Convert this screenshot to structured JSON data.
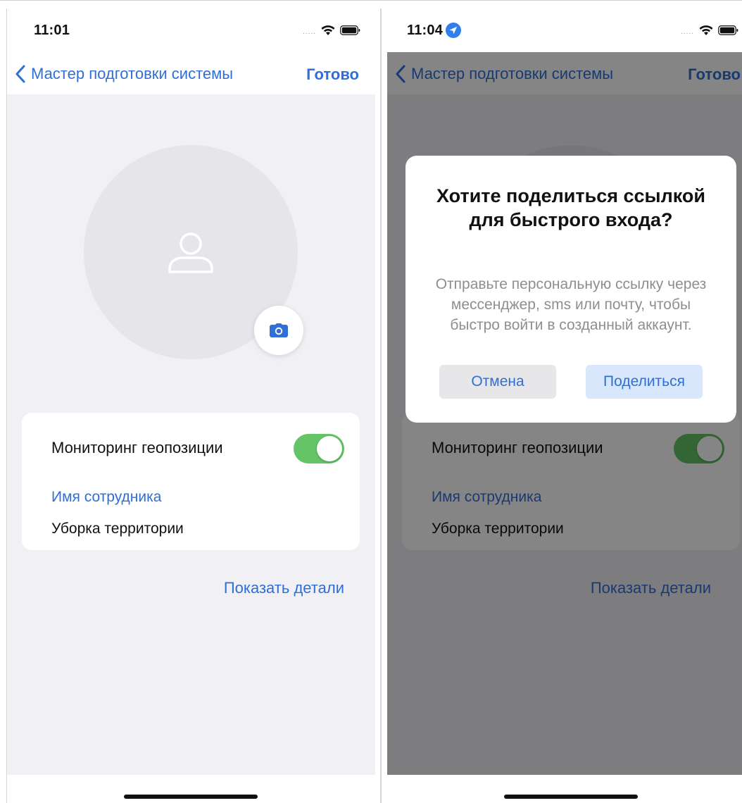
{
  "left_screen": {
    "status": {
      "time": "11:01",
      "signal_text": "....."
    },
    "nav": {
      "back_label": "Мастер подготовки системы",
      "done_label": "Готово"
    },
    "form": {
      "geo_label": "Мониторинг геопозиции",
      "geo_enabled": true,
      "employee_name_label": "Имя сотрудника",
      "employee_name_value": "Уборка территории"
    },
    "details_link": "Показать детали"
  },
  "right_screen": {
    "status": {
      "time": "11:04",
      "signal_text": "....."
    },
    "nav": {
      "back_label": "Мастер подготовки системы",
      "done_label": "Готово"
    },
    "form": {
      "geo_label": "Мониторинг геопозиции",
      "geo_enabled": true,
      "employee_name_label": "Имя сотрудника",
      "employee_name_value": "Уборка территории"
    },
    "details_link": "Показать детали",
    "alert": {
      "title": "Хотите поделиться ссылкой для быстрого входа?",
      "message": "Отправьте персональную ссылку через мессенджер, sms или почту, чтобы быстро войти в созданный аккаунт.",
      "cancel_label": "Отмена",
      "share_label": "Поделиться"
    }
  },
  "colors": {
    "accent": "#2f6fd6",
    "toggle_on": "#65c466",
    "background": "#f0f0f5",
    "avatar": "#e5e5ea"
  },
  "icons": [
    "chevron-left-icon",
    "person-icon",
    "camera-icon",
    "wifi-icon",
    "battery-icon",
    "location-arrow-icon"
  ]
}
